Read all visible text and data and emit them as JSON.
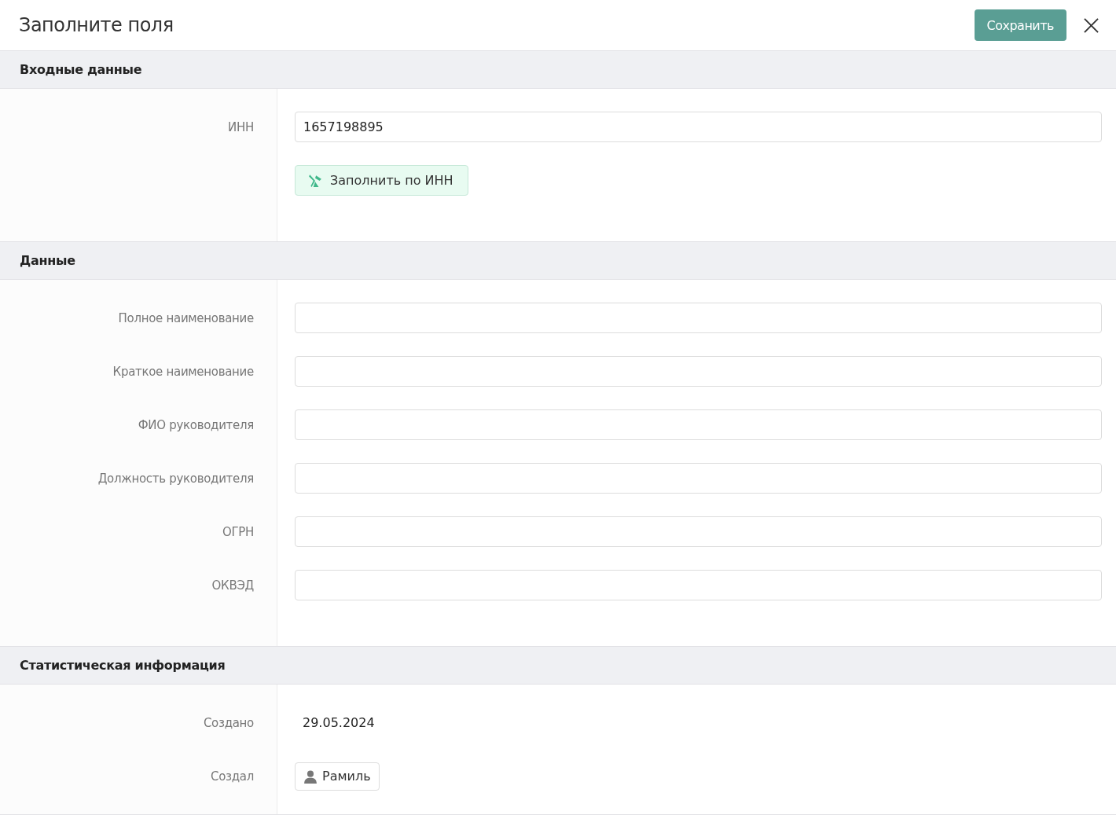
{
  "header": {
    "title": "Заполните поля",
    "save_button": "Сохранить"
  },
  "sections": [
    {
      "title": "Входные данные",
      "rows": [
        {
          "kind": "input",
          "label": "ИНН",
          "value": "1657198895"
        },
        {
          "kind": "button",
          "label": "",
          "button": "Заполнить по ИНН"
        }
      ]
    },
    {
      "title": "Данные",
      "rows": [
        {
          "kind": "input",
          "label": "Полное наименование",
          "value": ""
        },
        {
          "kind": "input",
          "label": "Краткое наименование",
          "value": ""
        },
        {
          "kind": "input",
          "label": "ФИО руководителя",
          "value": ""
        },
        {
          "kind": "input",
          "label": "Должность руководителя",
          "value": ""
        },
        {
          "kind": "input",
          "label": "ОГРН",
          "value": ""
        },
        {
          "kind": "input",
          "label": "ОКВЭД",
          "value": ""
        }
      ]
    },
    {
      "title": "Статистическая информация",
      "rows": [
        {
          "kind": "text",
          "label": "Создано",
          "value": "29.05.2024"
        },
        {
          "kind": "user",
          "label": "Создал",
          "value": "Рамиль"
        }
      ]
    }
  ]
}
